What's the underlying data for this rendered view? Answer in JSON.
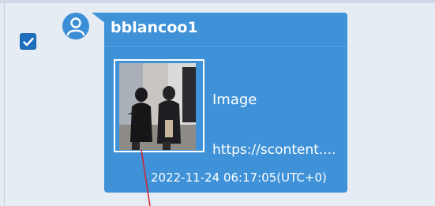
{
  "message": {
    "selected": true,
    "username": "bblancoo1",
    "attachment": {
      "type_label": "Image",
      "url_label": "https://scontent...."
    },
    "timestamp": "2022-11-24 06:17:05(UTC+0)"
  },
  "colors": {
    "background": "#e6ecf4",
    "bubble": "#3f92d8",
    "checkbox": "#1f6fbf",
    "annotation_line": "#d0202a"
  },
  "icons": {
    "checkbox": "checkmark-icon",
    "avatar": "user-icon"
  }
}
